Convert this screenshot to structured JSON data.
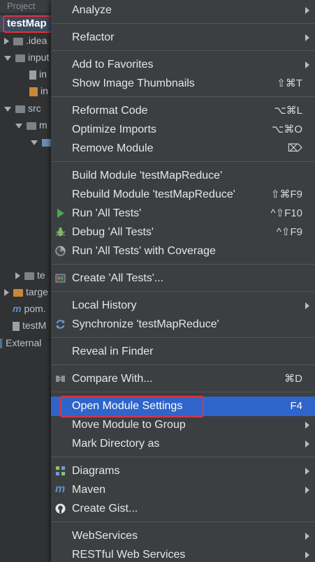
{
  "tree": {
    "header": "Project",
    "rows": [
      {
        "label": "testMap",
        "icon": "module-folder-icon"
      },
      {
        "label": ".idea",
        "icon": "folder-icon"
      },
      {
        "label": "input",
        "icon": "folder-icon"
      },
      {
        "label": "in",
        "icon": "file-icon"
      },
      {
        "label": "in",
        "icon": "xml-file-icon"
      },
      {
        "label": "src",
        "icon": "folder-icon"
      },
      {
        "label": "m",
        "icon": "folder-icon"
      },
      {
        "label": "te",
        "icon": "folder-icon"
      },
      {
        "label": "targe",
        "icon": "folder-orange-icon"
      },
      {
        "label": "pom.",
        "icon": "maven-file-icon"
      },
      {
        "label": "testM",
        "icon": "file-icon"
      },
      {
        "label": "External",
        "icon": "library-icon"
      }
    ]
  },
  "menu": {
    "items": [
      {
        "id": "analyze",
        "label": "Analyze",
        "shortcut": "",
        "submenu": true
      },
      {
        "id": "refactor",
        "label": "Refactor",
        "shortcut": "",
        "submenu": true
      },
      {
        "id": "add-favorites",
        "label": "Add to Favorites",
        "shortcut": "",
        "submenu": true
      },
      {
        "id": "show-thumbnails",
        "label": "Show Image Thumbnails",
        "shortcut": "⇧⌘T",
        "submenu": false
      },
      {
        "id": "reformat",
        "label": "Reformat Code",
        "shortcut": "⌥⌘L",
        "submenu": false
      },
      {
        "id": "optimize-imports",
        "label": "Optimize Imports",
        "shortcut": "⌥⌘O",
        "submenu": false
      },
      {
        "id": "remove-module",
        "label": "Remove Module",
        "shortcut": "⌦",
        "submenu": false
      },
      {
        "id": "build-module",
        "label": "Build Module 'testMapReduce'",
        "shortcut": "",
        "submenu": false
      },
      {
        "id": "rebuild-module",
        "label": "Rebuild Module 'testMapReduce'",
        "shortcut": "⇧⌘F9",
        "submenu": false
      },
      {
        "id": "run-tests",
        "label": "Run 'All Tests'",
        "shortcut": "^⇧F10",
        "submenu": false
      },
      {
        "id": "debug-tests",
        "label": "Debug 'All Tests'",
        "shortcut": "^⇧F9",
        "submenu": false
      },
      {
        "id": "run-coverage",
        "label": "Run 'All Tests' with Coverage",
        "shortcut": "",
        "submenu": false
      },
      {
        "id": "create-tests",
        "label": "Create 'All Tests'...",
        "shortcut": "",
        "submenu": false
      },
      {
        "id": "local-history",
        "label": "Local History",
        "shortcut": "",
        "submenu": true
      },
      {
        "id": "synchronize",
        "label": "Synchronize 'testMapReduce'",
        "shortcut": "",
        "submenu": false
      },
      {
        "id": "reveal-finder",
        "label": "Reveal in Finder",
        "shortcut": "",
        "submenu": false
      },
      {
        "id": "compare-with",
        "label": "Compare With...",
        "shortcut": "⌘D",
        "submenu": false
      },
      {
        "id": "open-module-settings",
        "label": "Open Module Settings",
        "shortcut": "F4",
        "submenu": false
      },
      {
        "id": "move-module-group",
        "label": "Move Module to Group",
        "shortcut": "",
        "submenu": true
      },
      {
        "id": "mark-directory",
        "label": "Mark Directory as",
        "shortcut": "",
        "submenu": true
      },
      {
        "id": "diagrams",
        "label": "Diagrams",
        "shortcut": "",
        "submenu": true
      },
      {
        "id": "maven",
        "label": "Maven",
        "shortcut": "",
        "submenu": true
      },
      {
        "id": "create-gist",
        "label": "Create Gist...",
        "shortcut": "",
        "submenu": false
      },
      {
        "id": "webservices",
        "label": "WebServices",
        "shortcut": "",
        "submenu": true
      },
      {
        "id": "restful",
        "label": "RESTful Web Services",
        "shortcut": "",
        "submenu": true
      }
    ]
  },
  "colors": {
    "menu_bg": "#3c3f41",
    "highlight": "#2f65ca",
    "annotation_red": "#e0323a",
    "run_green": "#4aa84e"
  }
}
